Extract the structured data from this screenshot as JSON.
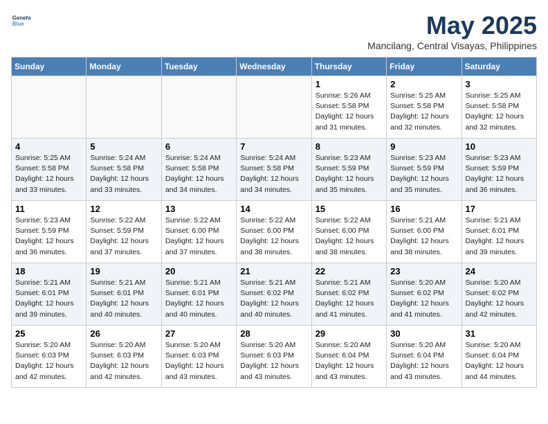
{
  "logo": {
    "line1": "General",
    "line2": "Blue"
  },
  "title": "May 2025",
  "subtitle": "Mancilang, Central Visayas, Philippines",
  "header": {
    "days": [
      "Sunday",
      "Monday",
      "Tuesday",
      "Wednesday",
      "Thursday",
      "Friday",
      "Saturday"
    ]
  },
  "weeks": [
    [
      {
        "day": "",
        "info": ""
      },
      {
        "day": "",
        "info": ""
      },
      {
        "day": "",
        "info": ""
      },
      {
        "day": "",
        "info": ""
      },
      {
        "day": "1",
        "info": "Sunrise: 5:26 AM\nSunset: 5:58 PM\nDaylight: 12 hours\nand 31 minutes."
      },
      {
        "day": "2",
        "info": "Sunrise: 5:25 AM\nSunset: 5:58 PM\nDaylight: 12 hours\nand 32 minutes."
      },
      {
        "day": "3",
        "info": "Sunrise: 5:25 AM\nSunset: 5:58 PM\nDaylight: 12 hours\nand 32 minutes."
      }
    ],
    [
      {
        "day": "4",
        "info": "Sunrise: 5:25 AM\nSunset: 5:58 PM\nDaylight: 12 hours\nand 33 minutes."
      },
      {
        "day": "5",
        "info": "Sunrise: 5:24 AM\nSunset: 5:58 PM\nDaylight: 12 hours\nand 33 minutes."
      },
      {
        "day": "6",
        "info": "Sunrise: 5:24 AM\nSunset: 5:58 PM\nDaylight: 12 hours\nand 34 minutes."
      },
      {
        "day": "7",
        "info": "Sunrise: 5:24 AM\nSunset: 5:58 PM\nDaylight: 12 hours\nand 34 minutes."
      },
      {
        "day": "8",
        "info": "Sunrise: 5:23 AM\nSunset: 5:59 PM\nDaylight: 12 hours\nand 35 minutes."
      },
      {
        "day": "9",
        "info": "Sunrise: 5:23 AM\nSunset: 5:59 PM\nDaylight: 12 hours\nand 35 minutes."
      },
      {
        "day": "10",
        "info": "Sunrise: 5:23 AM\nSunset: 5:59 PM\nDaylight: 12 hours\nand 36 minutes."
      }
    ],
    [
      {
        "day": "11",
        "info": "Sunrise: 5:23 AM\nSunset: 5:59 PM\nDaylight: 12 hours\nand 36 minutes."
      },
      {
        "day": "12",
        "info": "Sunrise: 5:22 AM\nSunset: 5:59 PM\nDaylight: 12 hours\nand 37 minutes."
      },
      {
        "day": "13",
        "info": "Sunrise: 5:22 AM\nSunset: 6:00 PM\nDaylight: 12 hours\nand 37 minutes."
      },
      {
        "day": "14",
        "info": "Sunrise: 5:22 AM\nSunset: 6:00 PM\nDaylight: 12 hours\nand 38 minutes."
      },
      {
        "day": "15",
        "info": "Sunrise: 5:22 AM\nSunset: 6:00 PM\nDaylight: 12 hours\nand 38 minutes."
      },
      {
        "day": "16",
        "info": "Sunrise: 5:21 AM\nSunset: 6:00 PM\nDaylight: 12 hours\nand 38 minutes."
      },
      {
        "day": "17",
        "info": "Sunrise: 5:21 AM\nSunset: 6:01 PM\nDaylight: 12 hours\nand 39 minutes."
      }
    ],
    [
      {
        "day": "18",
        "info": "Sunrise: 5:21 AM\nSunset: 6:01 PM\nDaylight: 12 hours\nand 39 minutes."
      },
      {
        "day": "19",
        "info": "Sunrise: 5:21 AM\nSunset: 6:01 PM\nDaylight: 12 hours\nand 40 minutes."
      },
      {
        "day": "20",
        "info": "Sunrise: 5:21 AM\nSunset: 6:01 PM\nDaylight: 12 hours\nand 40 minutes."
      },
      {
        "day": "21",
        "info": "Sunrise: 5:21 AM\nSunset: 6:02 PM\nDaylight: 12 hours\nand 40 minutes."
      },
      {
        "day": "22",
        "info": "Sunrise: 5:21 AM\nSunset: 6:02 PM\nDaylight: 12 hours\nand 41 minutes."
      },
      {
        "day": "23",
        "info": "Sunrise: 5:20 AM\nSunset: 6:02 PM\nDaylight: 12 hours\nand 41 minutes."
      },
      {
        "day": "24",
        "info": "Sunrise: 5:20 AM\nSunset: 6:02 PM\nDaylight: 12 hours\nand 42 minutes."
      }
    ],
    [
      {
        "day": "25",
        "info": "Sunrise: 5:20 AM\nSunset: 6:03 PM\nDaylight: 12 hours\nand 42 minutes."
      },
      {
        "day": "26",
        "info": "Sunrise: 5:20 AM\nSunset: 6:03 PM\nDaylight: 12 hours\nand 42 minutes."
      },
      {
        "day": "27",
        "info": "Sunrise: 5:20 AM\nSunset: 6:03 PM\nDaylight: 12 hours\nand 43 minutes."
      },
      {
        "day": "28",
        "info": "Sunrise: 5:20 AM\nSunset: 6:03 PM\nDaylight: 12 hours\nand 43 minutes."
      },
      {
        "day": "29",
        "info": "Sunrise: 5:20 AM\nSunset: 6:04 PM\nDaylight: 12 hours\nand 43 minutes."
      },
      {
        "day": "30",
        "info": "Sunrise: 5:20 AM\nSunset: 6:04 PM\nDaylight: 12 hours\nand 43 minutes."
      },
      {
        "day": "31",
        "info": "Sunrise: 5:20 AM\nSunset: 6:04 PM\nDaylight: 12 hours\nand 44 minutes."
      }
    ]
  ]
}
